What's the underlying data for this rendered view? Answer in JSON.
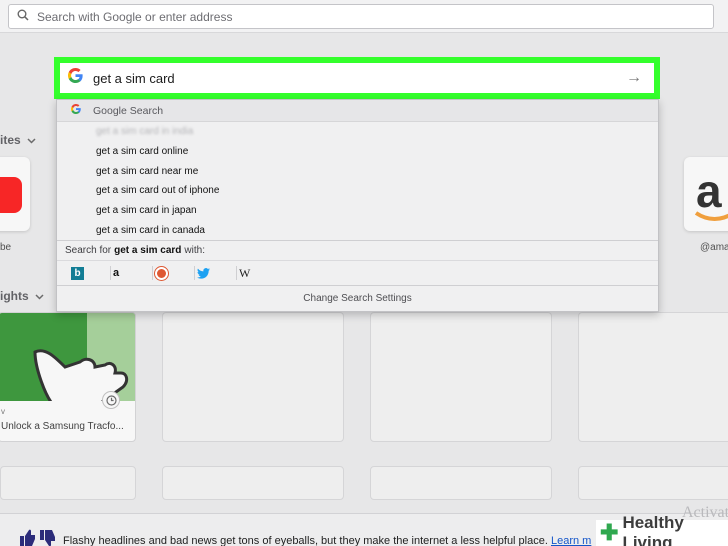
{
  "browser": {
    "address_placeholder": "Search with Google or enter address"
  },
  "top_sites": {
    "section_label": "ites",
    "left_tile_label": "be",
    "right_tile_label": "@ama"
  },
  "highlights": {
    "section_label": "ights",
    "card_site": "v",
    "card_title": "Unlock a Samsung Tracfo..."
  },
  "search": {
    "query": "get a sim card",
    "dropdown": {
      "header": "Google Search",
      "suggestions": [
        "get a sim card in india",
        "get a sim card online",
        "get a sim card near me",
        "get a sim card out of iphone",
        "get a sim card in japan",
        "get a sim card in canada"
      ],
      "search_for_prefix": "Search for",
      "search_for_query": "get a sim card",
      "search_for_suffix": "with:",
      "engines": [
        "bing-icon",
        "amazon-icon",
        "duckduckgo-icon",
        "twitter-icon",
        "wikipedia-icon"
      ],
      "change_settings": "Change Search Settings"
    }
  },
  "notice": {
    "message": "Flashy headlines and bad news get tons of eyeballs, but they make the internet a less helpful place.",
    "link": "Learn m"
  },
  "overlay": {
    "windows_activate": "Activat",
    "watermark": "Healthy Living"
  },
  "colors": {
    "highlight_green": "#34ff2c",
    "youtube_red": "#ff0000",
    "amazon_orange": "#f7941d"
  }
}
